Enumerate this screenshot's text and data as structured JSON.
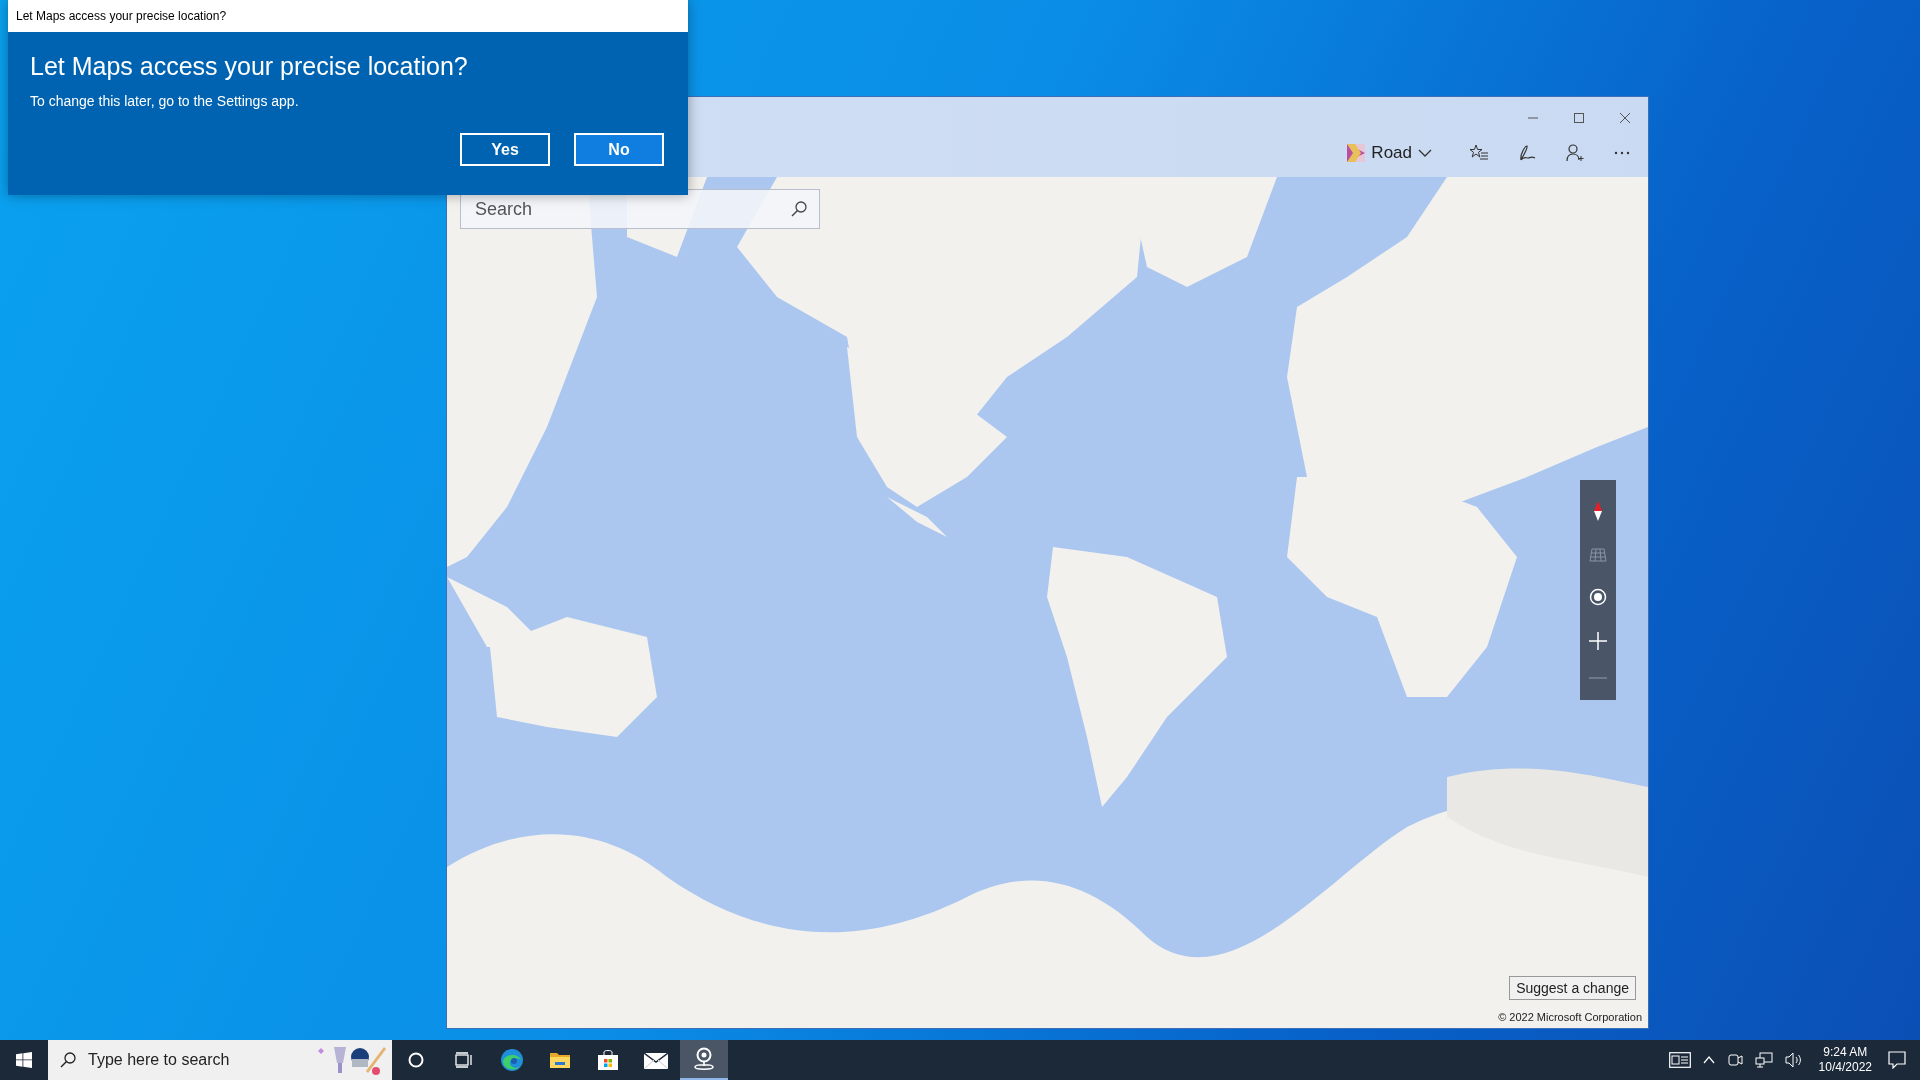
{
  "dialog": {
    "window_title": "Let Maps access your precise location?",
    "heading": "Let Maps access your precise location?",
    "message": "To change this later, go to the Settings app.",
    "buttons": [
      {
        "label": "Yes",
        "selected": false
      },
      {
        "label": "No",
        "selected": true
      }
    ]
  },
  "maps_window": {
    "map_style": "Road",
    "search": {
      "placeholder": "Search"
    },
    "suggest_button": "Suggest a change",
    "copyright": "© 2022 Microsoft Corporation"
  },
  "taskbar": {
    "search": {
      "placeholder": "Type here to search"
    },
    "apps": [
      {
        "kind": "cortana",
        "selected": false
      },
      {
        "kind": "taskview",
        "selected": false
      },
      {
        "kind": "edge",
        "selected": false
      },
      {
        "kind": "explorer",
        "selected": false
      },
      {
        "kind": "store",
        "selected": false
      },
      {
        "kind": "mail",
        "selected": false
      },
      {
        "kind": "maps",
        "selected": true
      }
    ],
    "clock": {
      "time": "9:24 AM",
      "date": "10/4/2022"
    }
  }
}
